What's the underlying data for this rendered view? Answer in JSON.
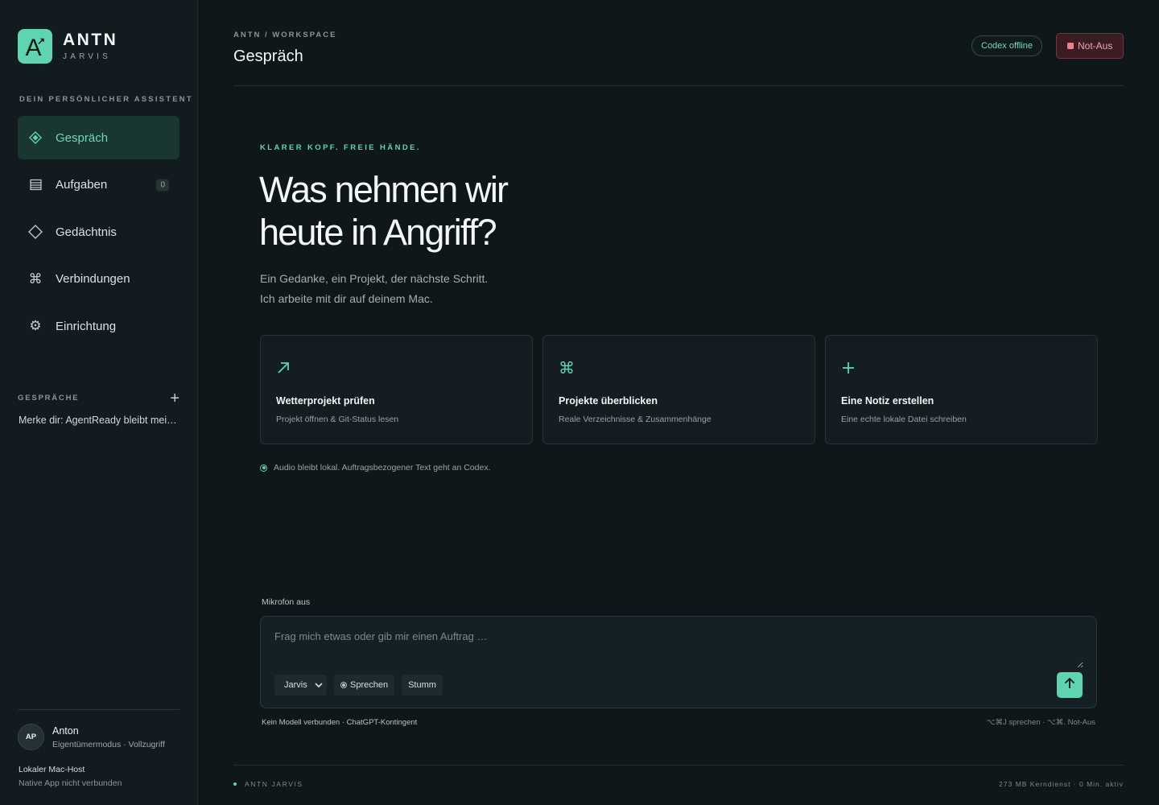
{
  "brand": {
    "name": "ANTN",
    "sub": "JARVIS",
    "logo_letter": "A",
    "logo_icon": "arrow-up-right-icon"
  },
  "sidebar": {
    "tagline": "DEIN PERSÖNLICHER ASSISTENT",
    "nav": [
      {
        "label": "Gespräch",
        "icon": "diamond-filled-icon",
        "active": true
      },
      {
        "label": "Aufgaben",
        "icon": "list-icon",
        "count": "0"
      },
      {
        "label": "Gedächtnis",
        "icon": "diamond-outline-icon"
      },
      {
        "label": "Verbindungen",
        "icon": "command-icon"
      },
      {
        "label": "Einrichtung",
        "icon": "gear-icon"
      }
    ],
    "conversations_title": "GESPRÄCHE",
    "conversations": [
      "Merke dir: AgentReady bleibt mein aktuelles Projekt"
    ],
    "user": {
      "initials": "AP",
      "name": "Anton",
      "mode": "Eigentümermodus · Vollzugriff"
    },
    "host": {
      "name": "Lokaler Mac-Host",
      "status": "Native App nicht verbunden"
    }
  },
  "header": {
    "breadcrumb": "ANTN / WORKSPACE",
    "title": "Gespräch",
    "codex_status": "Codex offline",
    "stop_label": "Not-Aus"
  },
  "hero": {
    "eyebrow": "KLARER KOPF. FREIE HÄNDE.",
    "headline": "Was nehmen wir heute in Angriff?",
    "lead_1": "Ein Gedanke, ein Projekt, der nächste Schritt.",
    "lead_2": "Ich arbeite mit dir auf deinem Mac."
  },
  "cards": [
    {
      "icon": "arrow-up-right-icon",
      "title": "Wetterprojekt prüfen",
      "subtitle": "Projekt öffnen & Git-Status lesen"
    },
    {
      "icon": "command-icon",
      "title": "Projekte überblicken",
      "subtitle": "Reale Verzeichnisse & Zusammenhänge"
    },
    {
      "icon": "plus-icon",
      "title": "Eine Notiz erstellen",
      "subtitle": "Eine echte lokale Datei schreiben"
    }
  ],
  "privacy_note": "Audio bleibt lokal. Auftragsbezogener Text geht an Codex.",
  "composer": {
    "mic_status": "Mikrofon aus",
    "placeholder": "Frag mich etwas oder gib mir einen Auftrag …",
    "agent_select": "Jarvis",
    "speak_label": "Sprechen",
    "mute_label": "Stumm",
    "model_status": "Kein Modell verbunden · ChatGPT-Kontingent",
    "shortcuts": "⌥⌘J sprechen · ⌥⌘. Not-Aus"
  },
  "footer": {
    "left": "ANTN JARVIS",
    "right": "273 MB Kerndienst · 0 Min. aktiv"
  },
  "colors": {
    "accent": "#5fd4b0",
    "background": "#0f171a",
    "sidebar": "#121c20",
    "danger": "#ef7f8c"
  }
}
